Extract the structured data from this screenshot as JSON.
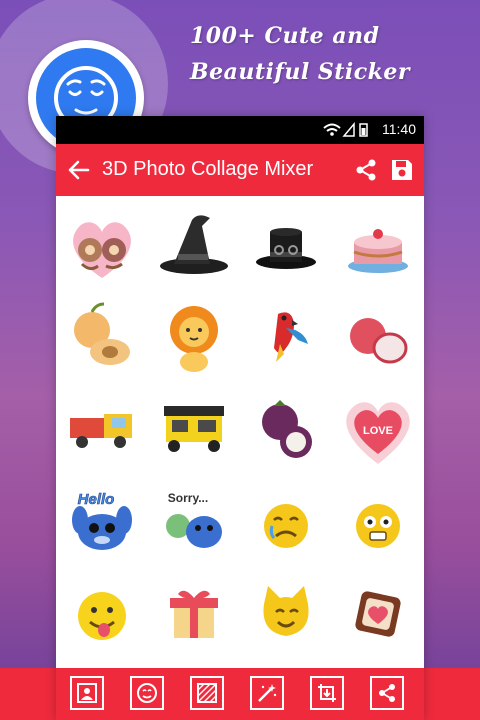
{
  "promo": {
    "line1": "100+ Cute and",
    "line2": "Beautiful Sticker"
  },
  "status_bar": {
    "time": "11:40"
  },
  "app_bar": {
    "title": "3D Photo Collage Mixer",
    "back_icon": "arrow-left-icon",
    "share_icon": "share-icon",
    "save_icon": "floppy-disk-icon"
  },
  "stickers": [
    "heart-couple-sticker",
    "witch-hat-sticker",
    "top-hat-sticker",
    "cake-sticker",
    "apricot-sticker",
    "lion-sticker",
    "parrot-sticker",
    "lychee-sticker",
    "truck-sticker",
    "auto-rickshaw-sticker",
    "mangosteen-sticker",
    "love-heart-sticker",
    "stitch-hello-sticker",
    "stitch-sorry-sticker",
    "crying-emoji-sticker",
    "scared-emoji-sticker",
    "tongue-emoji-sticker",
    "gift-box-sticker",
    "cat-face-sticker",
    "chocolate-heart-sticker"
  ],
  "love_text": "LOVE",
  "hello_text": "Hello",
  "sorry_text": "Sorry...",
  "bottom_tools": [
    "photo-frame-icon",
    "emoji-icon",
    "pattern-icon",
    "magic-wand-icon",
    "download-crop-icon",
    "share-icon"
  ],
  "colors": {
    "accent_red": "#ef2a3d",
    "badge_blue": "#2f7af0"
  }
}
